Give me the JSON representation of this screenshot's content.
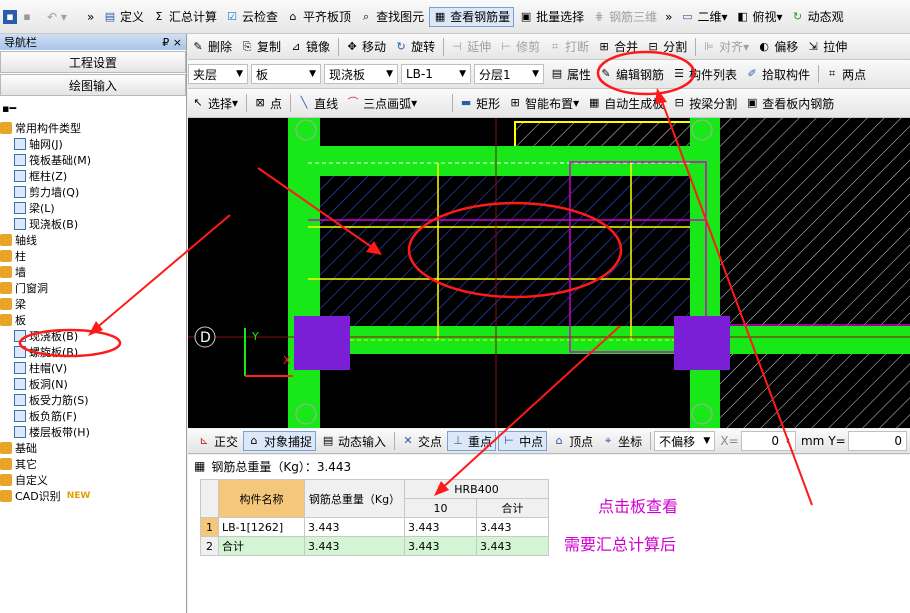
{
  "nav": {
    "title": "导航栏",
    "pin": "₽ ×",
    "project_settings": "工程设置",
    "drawing_input": "绘图输入"
  },
  "toolbar1": {
    "items": [
      "定义",
      "汇总计算",
      "云检查",
      "平齐板顶",
      "查找图元",
      "查看钢筋量",
      "批量选择",
      "钢筋三维",
      "二维",
      "俯视",
      "动态观"
    ]
  },
  "toolbar2": {
    "items": [
      "删除",
      "复制",
      "镜像",
      "移动",
      "旋转",
      "延伸",
      "修剪",
      "打断",
      "合并",
      "分割",
      "对齐",
      "偏移",
      "拉伸"
    ]
  },
  "toolbar3": {
    "layer": "夹层",
    "category": "板",
    "type": "现浇板",
    "component": "LB-1",
    "sublayer": "分层1",
    "items": [
      "属性",
      "编辑钢筋",
      "构件列表",
      "拾取构件",
      "两点"
    ]
  },
  "toolbar4": {
    "select": "选择",
    "items": [
      "点",
      "直线",
      "三点画弧",
      "矩形",
      "智能布置",
      "自动生成板",
      "按梁分割",
      "查看板内钢筋"
    ]
  },
  "tree": {
    "items": [
      {
        "label": "常用构件类型",
        "level": 0,
        "kind": "folder"
      },
      {
        "label": "轴网(J)",
        "level": 1,
        "kind": "leaf"
      },
      {
        "label": "筏板基础(M)",
        "level": 1,
        "kind": "leaf"
      },
      {
        "label": "框柱(Z)",
        "level": 1,
        "kind": "leaf"
      },
      {
        "label": "剪力墙(Q)",
        "level": 1,
        "kind": "leaf"
      },
      {
        "label": "梁(L)",
        "level": 1,
        "kind": "leaf"
      },
      {
        "label": "现浇板(B)",
        "level": 1,
        "kind": "leaf"
      },
      {
        "label": "轴线",
        "level": 0,
        "kind": "folder"
      },
      {
        "label": "柱",
        "level": 0,
        "kind": "folder"
      },
      {
        "label": "墙",
        "level": 0,
        "kind": "folder"
      },
      {
        "label": "门窗洞",
        "level": 0,
        "kind": "folder"
      },
      {
        "label": "梁",
        "level": 0,
        "kind": "folder"
      },
      {
        "label": "板",
        "level": 0,
        "kind": "folder"
      },
      {
        "label": "现浇板(B)",
        "level": 1,
        "kind": "leaf"
      },
      {
        "label": "螺旋板(B)",
        "level": 1,
        "kind": "leaf"
      },
      {
        "label": "柱帽(V)",
        "level": 1,
        "kind": "leaf"
      },
      {
        "label": "板洞(N)",
        "level": 1,
        "kind": "leaf"
      },
      {
        "label": "板受力筋(S)",
        "level": 1,
        "kind": "leaf"
      },
      {
        "label": "板负筋(F)",
        "level": 1,
        "kind": "leaf"
      },
      {
        "label": "楼层板带(H)",
        "level": 1,
        "kind": "leaf"
      },
      {
        "label": "基础",
        "level": 0,
        "kind": "folder"
      },
      {
        "label": "其它",
        "level": 0,
        "kind": "folder"
      },
      {
        "label": "自定义",
        "level": 0,
        "kind": "folder"
      },
      {
        "label": "CAD识别",
        "level": 0,
        "kind": "folder"
      }
    ],
    "new_badge": "NEW"
  },
  "canvas": {
    "axis_label": "D",
    "y_label": "Y",
    "x_label": "X"
  },
  "snapbar": {
    "items": [
      "正交",
      "对象捕捉",
      "动态输入",
      "交点",
      "重点",
      "中点",
      "顶点",
      "坐标"
    ],
    "offset_mode": "不偏移",
    "x_label": "X=",
    "x_value": "0",
    "unit": "mm",
    "y_label": "Y=",
    "y_value": "0"
  },
  "result": {
    "title": "钢筋总重量（Kg）：3.443",
    "col_name": "构件名称",
    "col_total": "钢筋总重量（Kg）",
    "col_group": "HRB400",
    "col_10": "10",
    "col_sum": "合计",
    "rows": [
      {
        "num": "1",
        "name": "LB-1[1262]",
        "total": "3.443",
        "v10": "3.443",
        "sum": "3.443"
      },
      {
        "num": "2",
        "name": "合计",
        "total": "3.443",
        "v10": "3.443",
        "sum": "3.443"
      }
    ]
  },
  "annotations": {
    "note1": "点击板查看",
    "note2": "需要汇总计算后"
  },
  "colors": {
    "beam_green": "#18e818",
    "column_purple": "#7a1fd6",
    "annotation_red": "#ff1a1a",
    "magenta": "#d000d0"
  }
}
